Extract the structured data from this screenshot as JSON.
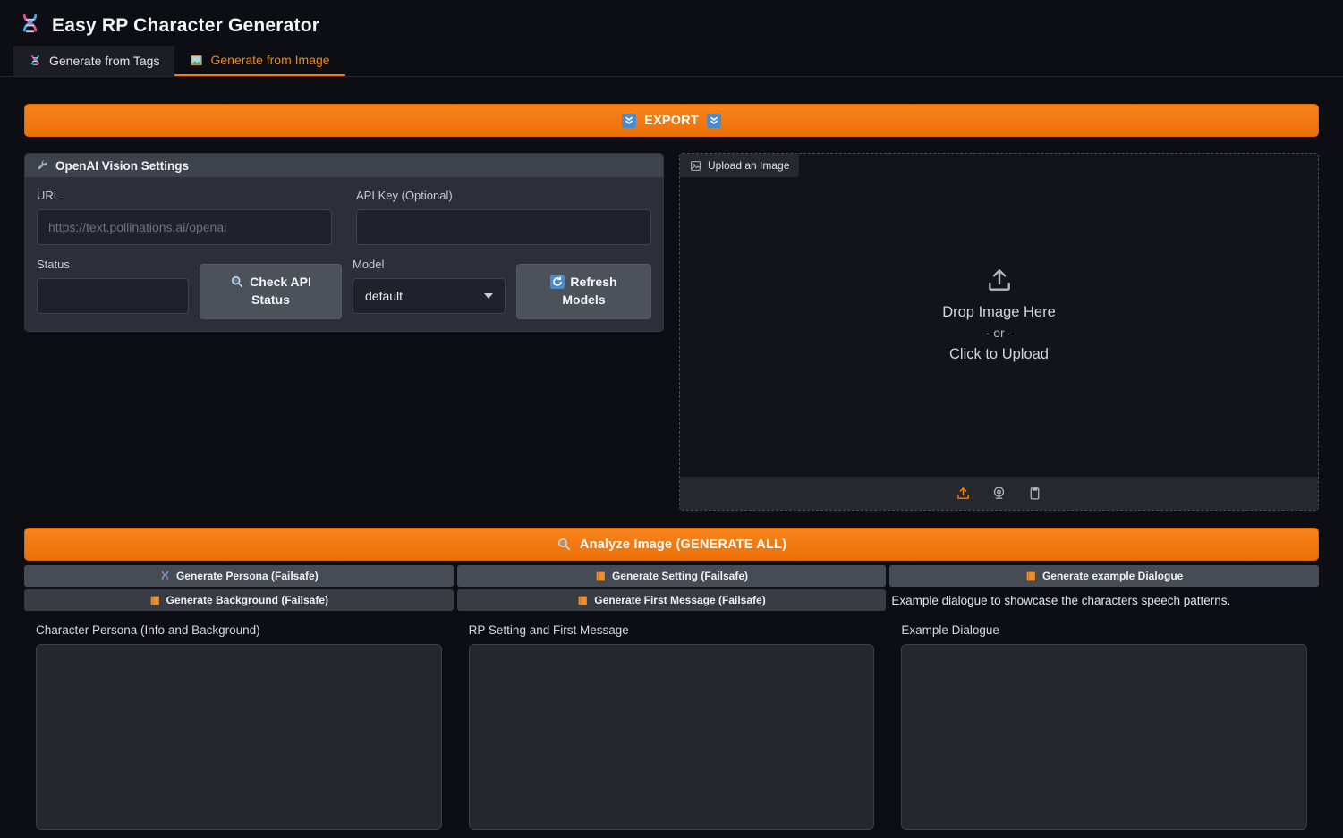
{
  "app": {
    "title": "Easy RP Character Generator"
  },
  "tabs": [
    {
      "label": "Generate from Tags",
      "active": false
    },
    {
      "label": "Generate from Image",
      "active": true
    }
  ],
  "export_button": {
    "label": "EXPORT"
  },
  "settings": {
    "title": "OpenAI Vision Settings",
    "url": {
      "label": "URL",
      "placeholder": "https://text.pollinations.ai/openai",
      "value": ""
    },
    "api_key": {
      "label": "API Key (Optional)",
      "value": ""
    },
    "status": {
      "label": "Status",
      "value": ""
    },
    "check_api_button": {
      "label": "Check API Status"
    },
    "model": {
      "label": "Model",
      "value": "default"
    },
    "refresh_button": {
      "label": "Refresh Models"
    }
  },
  "upload": {
    "tab_label": "Upload an Image",
    "drop_title": "Drop Image Here",
    "drop_or": "- or -",
    "drop_click": "Click to Upload"
  },
  "analyze_button": {
    "label": "Analyze Image (GENERATE ALL)"
  },
  "generators": {
    "columns": [
      {
        "buttons": [
          {
            "label": "Generate Persona (Failsafe)"
          },
          {
            "label": "Generate Background (Failsafe)"
          }
        ],
        "field_label": "Character Persona (Info and Background)",
        "value": ""
      },
      {
        "buttons": [
          {
            "label": "Generate Setting (Failsafe)"
          },
          {
            "label": "Generate First Message (Failsafe)"
          }
        ],
        "field_label": "RP Setting and First Message",
        "value": ""
      },
      {
        "buttons": [
          {
            "label": "Generate example Dialogue"
          }
        ],
        "note": "Example dialogue to showcase the characters speech patterns.",
        "field_label": "Example Dialogue",
        "value": ""
      }
    ]
  },
  "icons": {
    "logo": "dna-icon",
    "tab_tags": "dna-icon",
    "tab_image": "framed-picture-icon",
    "export": "double-down-arrow-icon",
    "settings_header": "wrench-icon",
    "check_api": "magnifier-icon",
    "refresh_models": "refresh-icon",
    "analyze": "magnifier-icon",
    "upload_drop": "upload-arrow-icon",
    "source_upload": "upload-arrow-icon",
    "source_webcam": "webcam-icon",
    "source_paste": "clipboard-icon",
    "generate_persona": "dna-icon",
    "generate_misc": "orange-book-icon",
    "model_caret": "chevron-down-icon"
  },
  "colors": {
    "accent": "#ff7c00",
    "primary_button": "#f0770d",
    "background": "#0c0e13",
    "panel": "#2c2f37",
    "panel_header": "#3e424b",
    "button_gray": "#4c515a"
  }
}
